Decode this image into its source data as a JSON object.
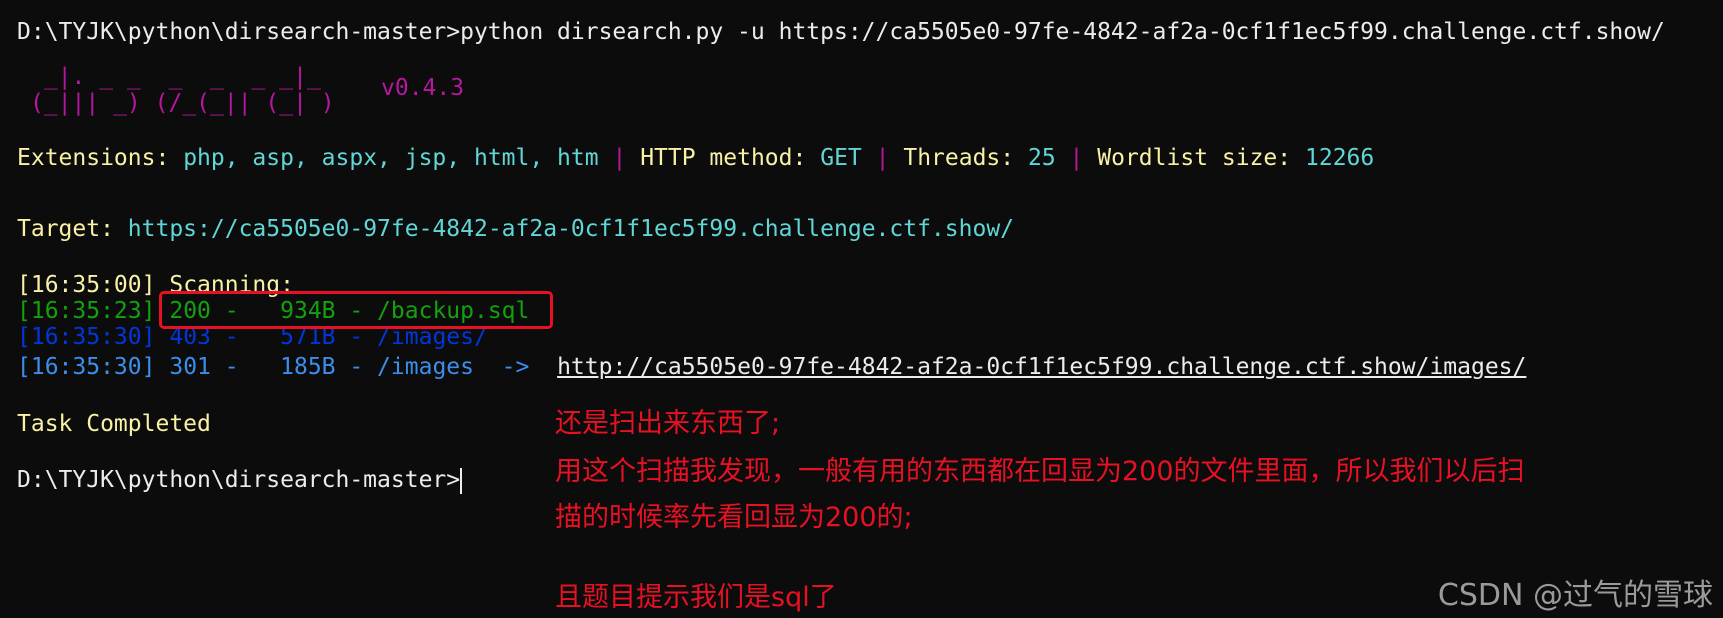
{
  "terminal": {
    "cmd_line": "D:\\TYJK\\python\\dirsearch-master>python dirsearch.py -u https://ca5505e0-97fe-4842-af2a-0cf1f1ec5f99.challenge.ctf.show/",
    "banner": {
      "ascii_1": " _|. _ _  _  _  _ _|_",
      "ascii_2": "(_||| _) (/_(_|| (_| )",
      "version": "v0.4.3"
    },
    "config": {
      "extensions_label": "Extensions:",
      "extensions_value": "php, asp, aspx, jsp, html, htm",
      "sep": "|",
      "method_label": "HTTP method:",
      "method_value": "GET",
      "threads_label": "Threads:",
      "threads_value": "25",
      "wordlist_label": "Wordlist size:",
      "wordlist_value": "12266"
    },
    "target": {
      "label": "Target:",
      "url": "https://ca5505e0-97fe-4842-af2a-0cf1f1ec5f99.challenge.ctf.show/"
    },
    "scan_start": {
      "time": "[16:35:00]",
      "text": "Scanning:"
    },
    "results": [
      {
        "time": "[16:35:23]",
        "text": "200 -   934B - /backup.sql",
        "redirect": ""
      },
      {
        "time": "[16:35:30]",
        "text": "403 -   571B - /images/",
        "redirect": ""
      },
      {
        "time": "[16:35:30]",
        "text": "301 -   185B - /images  ->",
        "redirect": "http://ca5505e0-97fe-4842-af2a-0cf1f1ec5f99.challenge.ctf.show/images/"
      }
    ],
    "task_done": "Task Completed",
    "prompt": "D:\\TYJK\\python\\dirsearch-master>"
  },
  "annotation": {
    "line1": "还是扫出来东西了;",
    "line2": "用这个扫描我发现，一般有用的东西都在回显为200的文件里面，所以我们以后扫",
    "line3": "描的时候率先看回显为200的;",
    "line4": "且题目提示我们是sql了",
    "color": "#e81123"
  },
  "watermark": "CSDN @过气的雪球"
}
